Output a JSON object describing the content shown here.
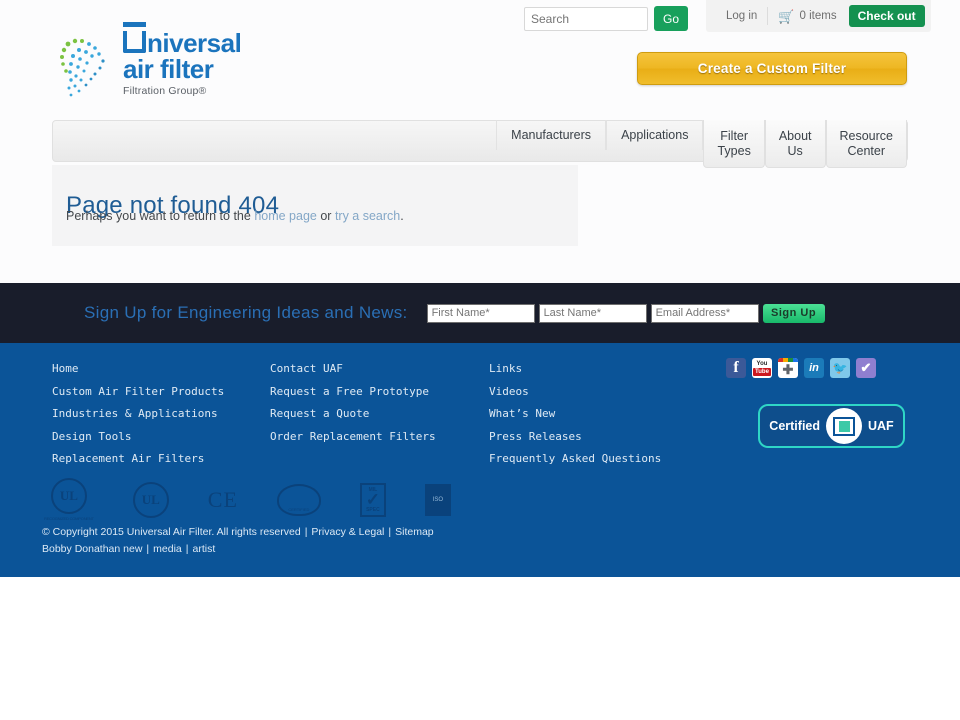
{
  "topbar": {
    "search_placeholder": "Search",
    "search_value": "",
    "go_label": "Go",
    "login_label": "Log in",
    "cart_icon": "shopping-cart-icon",
    "cart_label": "0 items",
    "checkout_label": "Check out"
  },
  "logo": {
    "word1": "niversal",
    "word2": "air filter",
    "tagline": "Filtration Group®",
    "brand_blue": "#1b74bd"
  },
  "cta": {
    "label": "Create a Custom Filter",
    "color": "#eeb723"
  },
  "nav": {
    "items": [
      {
        "label": "Manufacturers",
        "lines": [
          "Manufacturers"
        ],
        "tall": false
      },
      {
        "label": "Applications",
        "lines": [
          "Applications"
        ],
        "tall": false
      },
      {
        "label": "Filter Types",
        "lines": [
          "Filter",
          "Types"
        ],
        "tall": true
      },
      {
        "label": "About Us",
        "lines": [
          "About",
          "Us"
        ],
        "tall": true
      },
      {
        "label": "Resource Center",
        "lines": [
          "Resource",
          "Center"
        ],
        "tall": true
      }
    ]
  },
  "content": {
    "heading": "Page not found 404",
    "body_prefix": "Perhaps you want to return to the ",
    "link_home": "home page",
    "body_middle": " or ",
    "link_search": "try a search",
    "body_suffix": "."
  },
  "signup": {
    "title": "Sign Up for Engineering Ideas and News:",
    "first_name_placeholder": "First Name*",
    "first_name_value": "",
    "last_name_placeholder": "Last Name*",
    "last_name_value": "",
    "email_placeholder": "Email Address*",
    "email_value": "",
    "button_label": "Sign Up"
  },
  "footer": {
    "background": "#0b5498",
    "columns": [
      {
        "links": [
          "Home",
          "Custom Air Filter Products",
          "Industries & Applications",
          "Design Tools",
          "Replacement Air Filters"
        ]
      },
      {
        "links": [
          "Contact UAF",
          "Request a Free Prototype",
          "Request a Quote",
          "Order Replacement Filters"
        ]
      },
      {
        "links": [
          "Links",
          "Videos",
          "What’s New",
          "Press Releases",
          "Frequently Asked Questions"
        ]
      }
    ],
    "socials": [
      {
        "name": "facebook-icon",
        "glyph": "f"
      },
      {
        "name": "youtube-icon",
        "glyph": "You Tube"
      },
      {
        "name": "google-plus-icon",
        "glyph": "+"
      },
      {
        "name": "linkedin-icon",
        "glyph": "in"
      },
      {
        "name": "twitter-icon",
        "glyph": "t"
      },
      {
        "name": "check-icon",
        "glyph": "✔"
      }
    ],
    "cert_badge": {
      "left_label": "Certified",
      "right_label": "UAF",
      "icon": "filter-icon",
      "accent": "#2fd6c6"
    },
    "certifications": [
      {
        "name": "ul-recognized-component-icon",
        "text": "UL"
      },
      {
        "name": "ul-listed-icon",
        "text": "UL"
      },
      {
        "name": "ce-mark-icon",
        "text": "CE"
      },
      {
        "name": "seal-icon",
        "text": ""
      },
      {
        "name": "mil-spec-check-icon",
        "text": "MIL"
      },
      {
        "name": "compliance-square-icon",
        "text": ""
      }
    ],
    "copyright_line1": "© Copyright 2015 Universal Air Filter. All rights reserved",
    "privacy_label": "Privacy & Legal",
    "sitemap_label": "Sitemap",
    "credit_name": "Bobby Donathan new",
    "credit_media": "media",
    "credit_artist": "artist",
    "separator": "|"
  }
}
